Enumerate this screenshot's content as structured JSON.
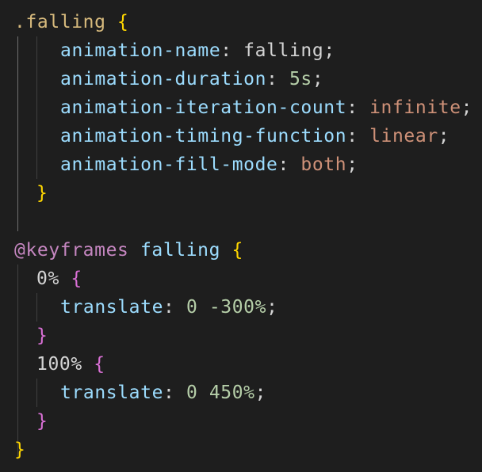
{
  "code": {
    "l1": {
      "selector": ".falling",
      "open": "{"
    },
    "l2": {
      "prop": "animation-name",
      "colon": ":",
      "value": "falling",
      "semi": ";"
    },
    "l3": {
      "prop": "animation-duration",
      "colon": ":",
      "value": "5s",
      "semi": ";"
    },
    "l4": {
      "prop": "animation-iteration-count",
      "colon": ":",
      "value": "infinite",
      "semi": ";"
    },
    "l5": {
      "prop": "animation-timing-function",
      "colon": ":",
      "value": "linear",
      "semi": ";"
    },
    "l6": {
      "prop": "animation-fill-mode",
      "colon": ":",
      "value": "both",
      "semi": ";"
    },
    "l7": {
      "close": "}"
    },
    "l9": {
      "at": "@keyframes",
      "name": "falling",
      "open": "{"
    },
    "l10": {
      "selector": "0%",
      "open": "{"
    },
    "l11": {
      "prop": "translate",
      "colon": ":",
      "v1": "0",
      "v2": "-300%",
      "semi": ";"
    },
    "l12": {
      "close": "}"
    },
    "l13": {
      "selector": "100%",
      "open": "{"
    },
    "l14": {
      "prop": "translate",
      "colon": ":",
      "v1": "0",
      "v2": "450%",
      "semi": ";"
    },
    "l15": {
      "close": "}"
    },
    "l16": {
      "close": "}"
    }
  },
  "theme": {
    "background": "#1e1e1e",
    "selector": "#d7ba7d",
    "property": "#9cdcfe",
    "number": "#b5cea8",
    "keyword_value": "#ce9178",
    "at_rule": "#c586c0",
    "bracket_level1": "#ffd700",
    "bracket_level2": "#da70d6"
  }
}
